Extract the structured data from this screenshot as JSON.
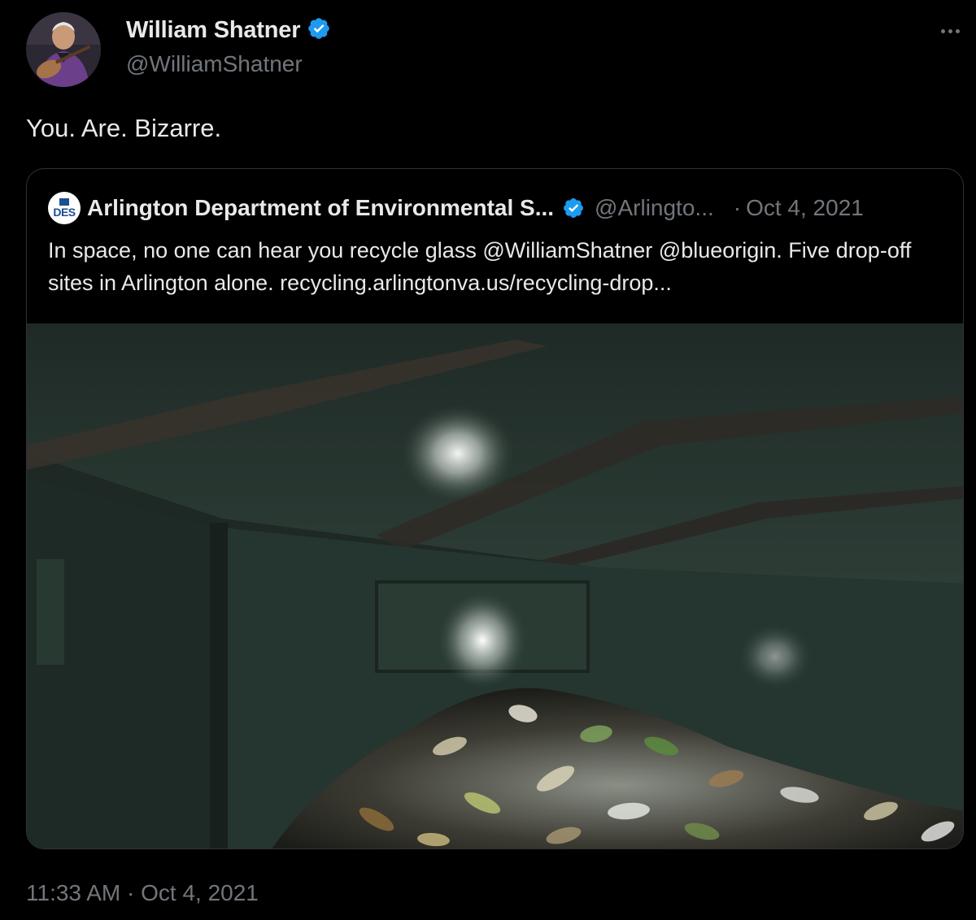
{
  "author": {
    "display_name": "William Shatner",
    "handle": "@WilliamShatner",
    "verified": true,
    "avatar_icon": "profile-photo"
  },
  "tweet": {
    "text": "You. Are. Bizarre.",
    "timestamp": "11:33 AM · Oct 4, 2021"
  },
  "quoted": {
    "avatar_label": "DES",
    "display_name": "Arlington Department of Environmental S...",
    "handle": "@Arlingto...",
    "separator": "·",
    "date": "Oct 4, 2021",
    "text": "In space, no one can hear you recycle glass @WilliamShatner @blueorigin. Five drop-off sites in Arlington alone. recycling.arlingtonva.us/recycling-drop...",
    "media_description": "inside-recycling-dumpster-with-glass-bottles"
  },
  "colors": {
    "background": "#000000",
    "text": "#e7e9ea",
    "muted": "#71767b",
    "border": "#2f3336",
    "verified_badge": "#1d9bf0"
  },
  "icons": {
    "verified": "verified-badge-icon",
    "more": "more-options-icon"
  }
}
